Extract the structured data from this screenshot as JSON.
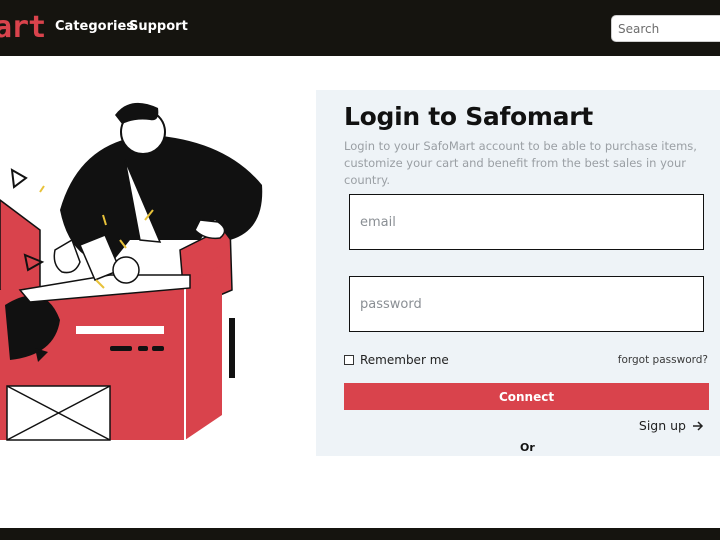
{
  "header": {
    "logo_text": "art",
    "nav": [
      {
        "label": "Categories"
      },
      {
        "label": "Support"
      }
    ],
    "search_placeholder": "Search"
  },
  "login": {
    "title": "Login to Safomart",
    "subtitle": "Login to your SafoMart account to be able to purchase items, customize your cart and benefit from the best sales in your country.",
    "email_placeholder": "email",
    "password_placeholder": "password",
    "remember_label": "Remember me",
    "forgot_label": "forgot password?",
    "connect_label": "Connect",
    "signup_label": "Sign up",
    "or_label": "Or"
  },
  "colors": {
    "brand": "#d9434c",
    "header_bg": "#15140f",
    "panel_bg": "#eef3f7"
  },
  "illustration": {
    "description_icon": "person-unboxing-illustration"
  }
}
